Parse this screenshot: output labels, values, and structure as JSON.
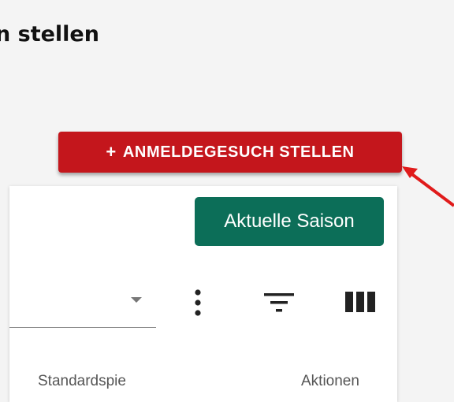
{
  "header": {
    "title": "n stellen"
  },
  "actions": {
    "register_button": "ANMELDEGESUCH STELLEN",
    "register_icon": "+"
  },
  "card": {
    "season_button": "Aktuelle Saison",
    "toolbar": {
      "select_value": "",
      "icons": [
        "dropdown-arrow-icon",
        "more-vertical-icon",
        "filter-icon",
        "columns-icon"
      ]
    },
    "columns": [
      "Standardspie",
      "Aktionen"
    ]
  },
  "colors": {
    "red": "#c4161c",
    "green": "#0c6e58",
    "arrow": "#e01b1b"
  }
}
